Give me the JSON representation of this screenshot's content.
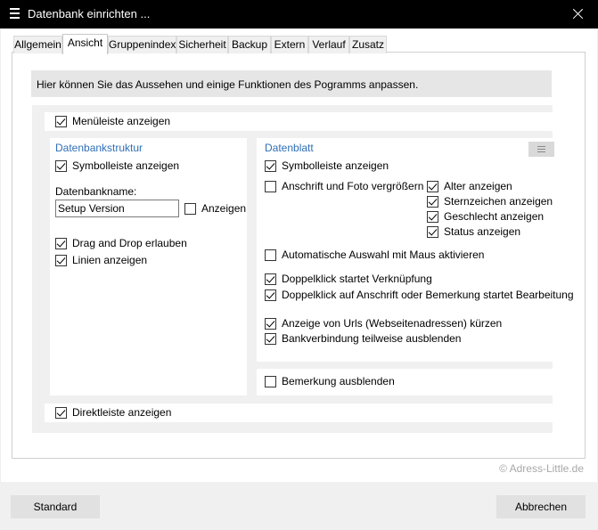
{
  "window": {
    "title": "Datenbank einrichten ..."
  },
  "tabs": [
    "Allgemein",
    "Ansicht",
    "Gruppenindex",
    "Sicherheit",
    "Backup",
    "Extern",
    "Verlauf",
    "Zusatz"
  ],
  "active_tab": "Ansicht",
  "info_text": "Hier können Sie das Aussehen und einige Funktionen des Pogramms anpassen.",
  "menu_bar": {
    "label": "Menüleiste anzeigen",
    "checked": true
  },
  "db_structure": {
    "title": "Datenbankstruktur",
    "symbol_bar": {
      "label": "Symbolleiste anzeigen",
      "checked": true
    },
    "db_name_label": "Datenbankname:",
    "db_name_value": "Setup Version",
    "show_name": {
      "label": "Anzeigen",
      "checked": false
    },
    "drag_drop": {
      "label": "Drag and Drop erlauben",
      "checked": true
    },
    "lines": {
      "label": "Linien anzeigen",
      "checked": true
    }
  },
  "datasheet": {
    "title": "Datenblatt",
    "symbol_bar": {
      "label": "Symbolleiste anzeigen",
      "checked": true
    },
    "enlarge_address": {
      "label": "Anschrift und Foto vergrößern",
      "checked": false
    },
    "show_age": {
      "label": "Alter anzeigen",
      "checked": true
    },
    "show_star_sign": {
      "label": "Sternzeichen anzeigen",
      "checked": true
    },
    "show_gender": {
      "label": "Geschlecht anzeigen",
      "checked": true
    },
    "show_status": {
      "label": "Status anzeigen",
      "checked": true
    },
    "auto_select": {
      "label": "Automatische Auswahl mit Maus aktivieren",
      "checked": false
    },
    "dblclick_link": {
      "label": "Doppelklick startet Verknüpfung",
      "checked": true
    },
    "dblclick_edit": {
      "label": "Doppelklick auf Anschrift oder Bemerkung startet Bearbeitung",
      "checked": true
    },
    "shorten_urls": {
      "label": "Anzeige von Urls (Webseitenadressen) kürzen",
      "checked": true
    },
    "hide_bank": {
      "label": "Bankverbindung teilweise ausblenden",
      "checked": true
    },
    "menu_icon": "hamburger-icon"
  },
  "hide_remark": {
    "label": "Bemerkung ausblenden",
    "checked": false
  },
  "direct_bar": {
    "label": "Direktleiste anzeigen",
    "checked": true
  },
  "watermark": "© Adress-Little.de",
  "buttons": {
    "standard": "Standard",
    "cancel": "Abbrechen"
  }
}
